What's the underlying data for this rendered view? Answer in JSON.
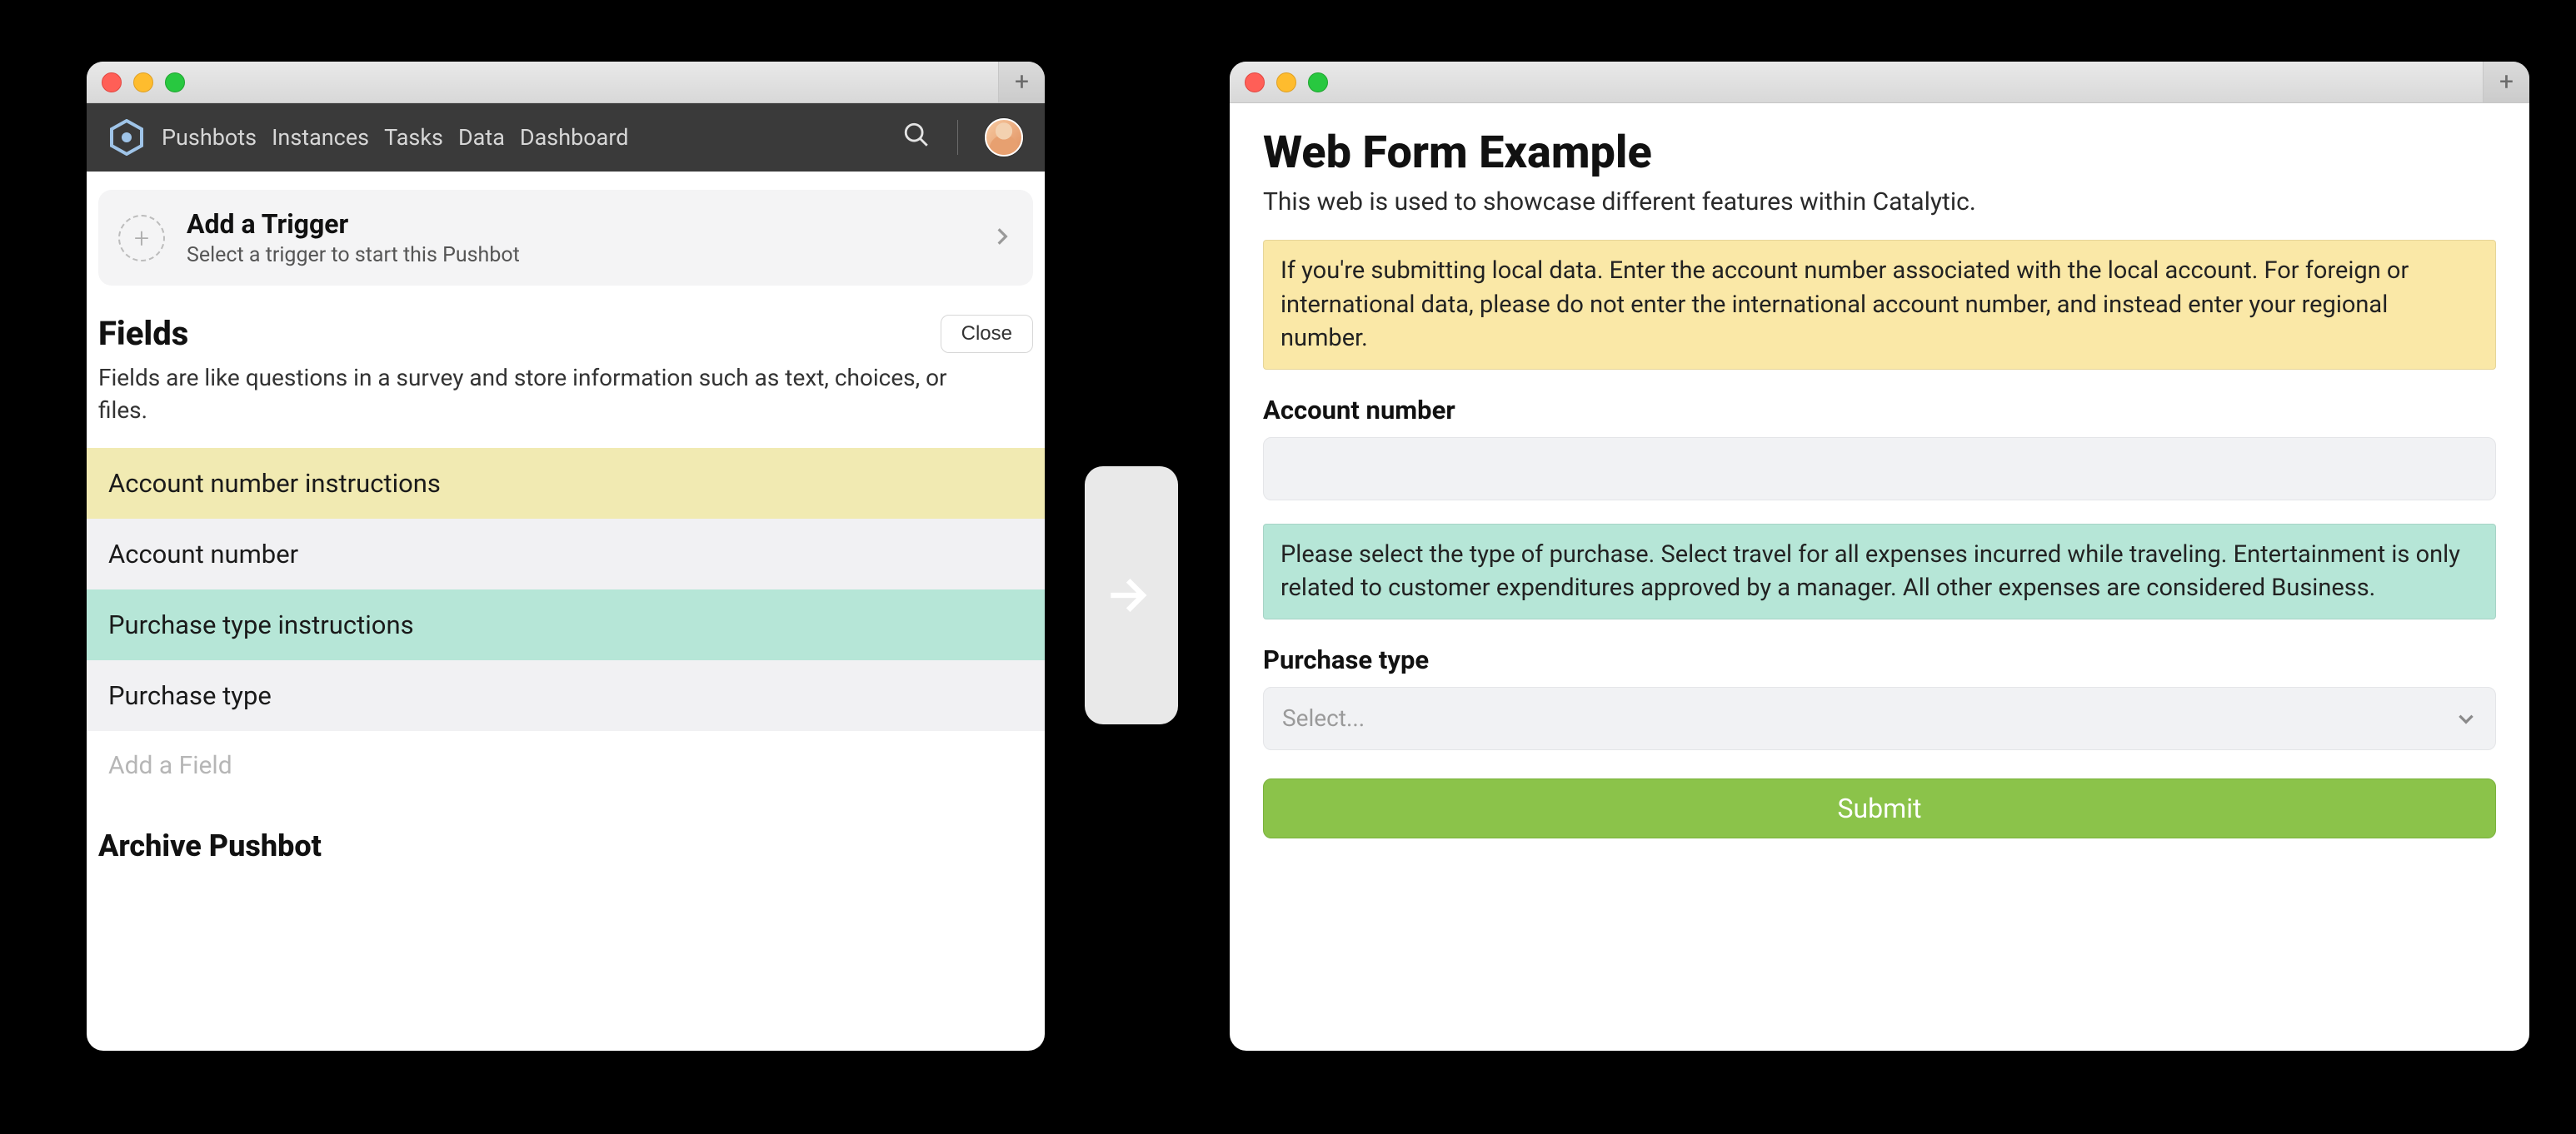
{
  "left": {
    "nav": {
      "items": [
        "Pushbots",
        "Instances",
        "Tasks",
        "Data",
        "Dashboard"
      ]
    },
    "trigger": {
      "title": "Add a Trigger",
      "subtitle": "Select a trigger to start this Pushbot"
    },
    "fields_section": {
      "heading": "Fields",
      "close_label": "Close",
      "description": "Fields are like questions in a survey and store information such as text, choices, or files."
    },
    "fields": [
      {
        "label": "Account number instructions",
        "colorClass": "field-yellow"
      },
      {
        "label": "Account number",
        "colorClass": "field-gray"
      },
      {
        "label": "Purchase type instructions",
        "colorClass": "field-teal"
      },
      {
        "label": "Purchase type",
        "colorClass": "field-gray"
      }
    ],
    "add_field_placeholder": "Add a Field",
    "archive_heading": "Archive Pushbot"
  },
  "right": {
    "title": "Web Form Example",
    "subtitle": "This web is used to showcase different features within Catalytic.",
    "callout_yellow": "If you're submitting local data. Enter the account number associated with the local account. For foreign or international data, please do not enter the international account number, and instead enter your regional number.",
    "account_label": "Account number",
    "account_value": "",
    "callout_teal": "Please select the type of purchase. Select travel for all expenses incurred while traveling. Entertainment is only related to customer expenditures approved by a manager. All other expenses are considered Business.",
    "purchase_label": "Purchase type",
    "select_placeholder": "Select...",
    "submit_label": "Submit"
  }
}
